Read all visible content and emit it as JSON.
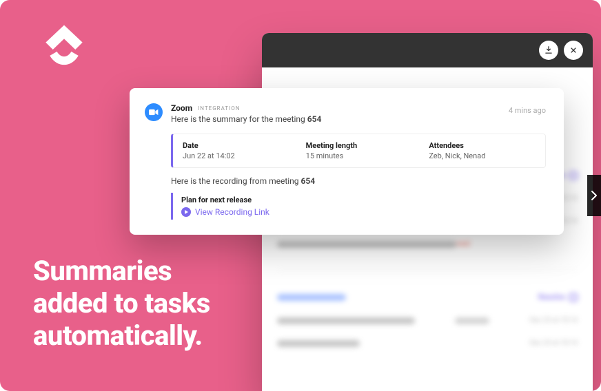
{
  "brand": {
    "name": "ClickUp"
  },
  "headline": {
    "line1": "Summaries",
    "line2": "added to tasks",
    "line3": "automatically."
  },
  "card": {
    "integration_name": "Zoom",
    "integration_badge": "INTEGRATION",
    "summary_prefix": "Here is the summary for the meeting ",
    "meeting_id": "654",
    "timestamp": "4 mins ago",
    "details": {
      "date_label": "Date",
      "date_value": "Jun 22 at 14:02",
      "length_label": "Meeting length",
      "length_value": "15 minutes",
      "attendees_label": "Attendees",
      "attendees_value": "Zeb, Nick, Nenad"
    },
    "recording_prefix": "Here is the recording from meeting ",
    "recording_title": "Plan for next release",
    "recording_link_label": "View Recording Link"
  },
  "window": {
    "resolve_label": "Resolve",
    "date_stub": "Dec 23 at 10:14",
    "unread_label": "Unread",
    "read_label": "read"
  }
}
